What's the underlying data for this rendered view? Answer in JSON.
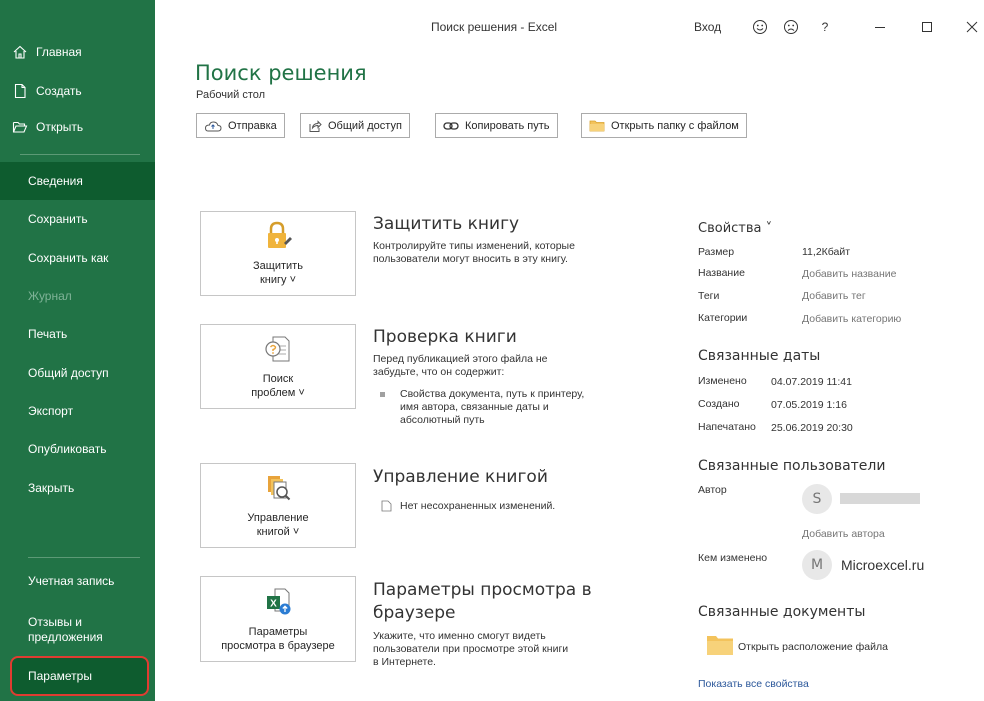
{
  "window": {
    "title": "Поиск решения  -  Excel",
    "signin": "Вход",
    "help": "?"
  },
  "sidebar": {
    "top_items": [
      {
        "label": "Главная",
        "icon": "home-icon"
      },
      {
        "label": "Создать",
        "icon": "new-file-icon"
      },
      {
        "label": "Открыть",
        "icon": "open-folder-icon"
      }
    ],
    "items": [
      {
        "label": "Сведения",
        "active": true
      },
      {
        "label": "Сохранить"
      },
      {
        "label": "Сохранить как"
      },
      {
        "label": "Журнал",
        "disabled": true
      },
      {
        "label": "Печать"
      },
      {
        "label": "Общий доступ"
      },
      {
        "label": "Экспорт"
      },
      {
        "label": "Опубликовать"
      },
      {
        "label": "Закрыть"
      }
    ],
    "bottom_items": [
      {
        "label": "Учетная запись"
      },
      {
        "label": "Отзывы и предложения"
      },
      {
        "label": "Параметры"
      }
    ]
  },
  "header": {
    "title": "Поиск решения",
    "location": "Рабочий стол",
    "buttons": [
      {
        "label": "Отправка",
        "icon": "upload-cloud-icon"
      },
      {
        "label": "Общий доступ",
        "icon": "share-icon"
      },
      {
        "label": "Копировать путь",
        "icon": "link-icon"
      },
      {
        "label": "Открыть папку с файлом",
        "icon": "folder-icon"
      }
    ]
  },
  "sections": {
    "protect": {
      "button_line1": "Защитить",
      "button_line2": "книгу ˅",
      "title": "Защитить книгу",
      "desc_line1": "Контролируйте типы изменений, которые",
      "desc_line2": "пользователи могут вносить в эту книгу."
    },
    "inspect": {
      "button_line1": "Поиск",
      "button_line2": "проблем ˅",
      "title": "Проверка книги",
      "desc_line1": "Перед публикацией этого файла не",
      "desc_line2": "забудьте, что он содержит:",
      "bullet_line1": "Свойства документа, путь к принтеру,",
      "bullet_line2": "имя автора, связанные даты и",
      "bullet_line3": "абсолютный путь"
    },
    "manage": {
      "button_line1": "Управление",
      "button_line2": "книгой ˅",
      "title": "Управление книгой",
      "item": "Нет несохраненных изменений."
    },
    "browser": {
      "button_line1": "Параметры",
      "button_line2": "просмотра в браузере",
      "title_line1": "Параметры просмотра в",
      "title_line2": "браузере",
      "desc_line1": "Укажите, что именно смогут видеть",
      "desc_line2": "пользователи при просмотре этой книги",
      "desc_line3": "в Интернете."
    }
  },
  "properties": {
    "heading": "Свойства ˅",
    "rows": [
      {
        "label": "Размер",
        "value": "11,2Кбайт"
      },
      {
        "label": "Название",
        "value": "Добавить название"
      },
      {
        "label": "Теги",
        "value": "Добавить тег"
      },
      {
        "label": "Категории",
        "value": "Добавить категорию"
      }
    ]
  },
  "dates": {
    "heading": "Связанные даты",
    "rows": [
      {
        "label": "Изменено",
        "value": "04.07.2019 11:41"
      },
      {
        "label": "Создано",
        "value": "07.05.2019 1:16"
      },
      {
        "label": "Напечатано",
        "value": "25.06.2019 20:30"
      }
    ]
  },
  "people": {
    "heading": "Связанные пользователи",
    "author_label": "Автор",
    "author_initial": "S",
    "add_author": "Добавить автора",
    "modified_label": "Кем изменено",
    "modified_initial": "M",
    "modified_name": "Microexcel.ru"
  },
  "documents": {
    "heading": "Связанные документы",
    "open_location": "Открыть расположение файла",
    "show_all": "Показать все свойства"
  },
  "colors": {
    "accent": "#217346",
    "active": "#0e5c2f",
    "highlight": "#e03c31"
  }
}
